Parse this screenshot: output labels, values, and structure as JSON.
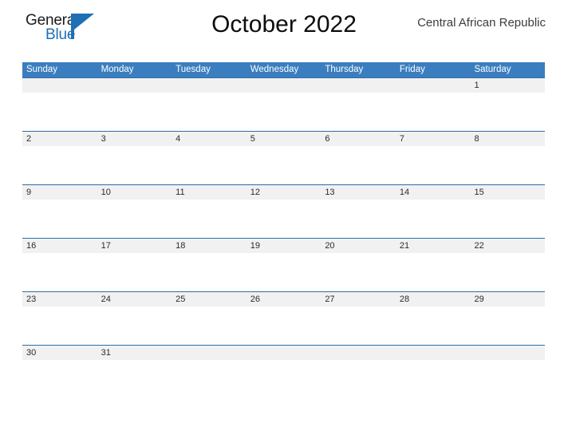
{
  "brand": {
    "name_part1": "General",
    "name_part2": "Blue",
    "logo_icon": "flag-triangle-icon",
    "accent_color": "#1f6fb5"
  },
  "header": {
    "title": "October 2022",
    "country": "Central African Republic"
  },
  "calendar": {
    "month": "October",
    "year": "2022",
    "header_bg_color": "#3b7ebf",
    "row_band_color": "#f1f1f1",
    "row_border_color": "#2d6da3",
    "weekdays": [
      "Sunday",
      "Monday",
      "Tuesday",
      "Wednesday",
      "Thursday",
      "Friday",
      "Saturday"
    ],
    "weeks": [
      [
        "",
        "",
        "",
        "",
        "",
        "",
        "1"
      ],
      [
        "2",
        "3",
        "4",
        "5",
        "6",
        "7",
        "8"
      ],
      [
        "9",
        "10",
        "11",
        "12",
        "13",
        "14",
        "15"
      ],
      [
        "16",
        "17",
        "18",
        "19",
        "20",
        "21",
        "22"
      ],
      [
        "23",
        "24",
        "25",
        "26",
        "27",
        "28",
        "29"
      ],
      [
        "30",
        "31",
        "",
        "",
        "",
        "",
        ""
      ]
    ]
  }
}
